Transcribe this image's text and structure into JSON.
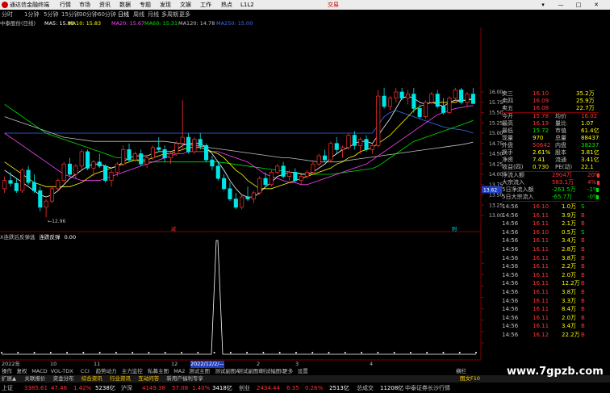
{
  "menu": {
    "app_title": "通达信金融终端",
    "items": [
      "行情",
      "市场",
      "资讯",
      "数据",
      "专题",
      "发现",
      "文娱",
      "工作",
      "热点",
      "L1L2"
    ],
    "trade": "交易",
    "window_controls": [
      "▾",
      "—",
      "□",
      "✕"
    ]
  },
  "period_bar": {
    "items": [
      "分时",
      "1分钟",
      "5分钟",
      "15分钟",
      "30分钟",
      "60分钟",
      "日线",
      "周线",
      "月线",
      "多周期",
      "更多"
    ],
    "active_index": 6
  },
  "ma_line": {
    "stock": "中泰股份(日线)",
    "items": [
      {
        "label": "MA5: 15.81",
        "color": "#ffffff"
      },
      {
        "label": "MA10: 15.83",
        "color": "#ffff00"
      },
      {
        "label": "MA20: 15.67",
        "color": "#ff44ff"
      },
      {
        "label": "MA60: 15.31",
        "color": "#00e600"
      },
      {
        "label": "MA120: 14.78",
        "color": "#c0c0c0"
      },
      {
        "label": "MA250: 15.00",
        "color": "#3c6cff"
      }
    ]
  },
  "chart_data": {
    "type": "candlestick",
    "y_ticks": [
      "16.00",
      "15.75",
      "15.50",
      "15.25",
      "15.00",
      "14.75",
      "14.50",
      "14.25",
      "14.00",
      "13.75",
      "13.50",
      "13.25",
      "13.00"
    ],
    "low_label": "←12.96",
    "price_tag": "13.62",
    "candles": [
      [
        13.65,
        13.95,
        13.55,
        13.85
      ],
      [
        13.85,
        14.05,
        13.7,
        13.78
      ],
      [
        13.78,
        13.9,
        13.55,
        13.6
      ],
      [
        13.6,
        14.15,
        13.55,
        14.1
      ],
      [
        14.1,
        14.2,
        13.75,
        13.8
      ],
      [
        13.8,
        14.0,
        13.55,
        13.6
      ],
      [
        13.6,
        13.7,
        13.1,
        13.2
      ],
      [
        13.2,
        13.4,
        12.96,
        13.35
      ],
      [
        13.35,
        13.7,
        13.3,
        13.65
      ],
      [
        13.65,
        13.9,
        13.6,
        13.85
      ],
      [
        13.85,
        14.3,
        13.8,
        14.25
      ],
      [
        14.25,
        14.4,
        13.95,
        14.0
      ],
      [
        14.0,
        14.25,
        13.9,
        14.2
      ],
      [
        14.2,
        14.6,
        14.1,
        14.55
      ],
      [
        14.55,
        14.6,
        14.1,
        14.15
      ],
      [
        14.15,
        14.35,
        13.95,
        14.3
      ],
      [
        14.3,
        14.5,
        14.15,
        14.2
      ],
      [
        14.2,
        14.25,
        13.8,
        13.85
      ],
      [
        13.85,
        14.1,
        13.7,
        14.05
      ],
      [
        14.05,
        14.3,
        13.95,
        14.25
      ],
      [
        14.25,
        14.7,
        14.2,
        14.6
      ],
      [
        14.6,
        14.75,
        14.3,
        14.35
      ],
      [
        14.35,
        14.55,
        14.3,
        14.5
      ],
      [
        14.5,
        14.6,
        14.2,
        14.25
      ],
      [
        14.25,
        14.45,
        14.15,
        14.4
      ],
      [
        14.4,
        14.7,
        14.35,
        14.65
      ],
      [
        14.65,
        14.9,
        14.55,
        14.6
      ],
      [
        14.6,
        14.7,
        14.3,
        14.4
      ],
      [
        14.4,
        14.55,
        14.25,
        14.5
      ],
      [
        14.5,
        14.8,
        14.45,
        14.75
      ],
      [
        14.75,
        15.8,
        14.6,
        14.9
      ],
      [
        14.9,
        15.0,
        14.5,
        14.55
      ],
      [
        14.55,
        14.9,
        14.5,
        14.85
      ],
      [
        14.85,
        15.0,
        14.6,
        14.7
      ],
      [
        14.7,
        14.75,
        14.3,
        14.35
      ],
      [
        14.35,
        14.45,
        14.1,
        14.2
      ],
      [
        14.2,
        14.3,
        13.85,
        13.9
      ],
      [
        13.9,
        14.0,
        13.6,
        13.65
      ],
      [
        13.65,
        13.8,
        13.35,
        13.4
      ],
      [
        13.4,
        13.55,
        13.15,
        13.2
      ],
      [
        13.2,
        13.5,
        13.15,
        13.45
      ],
      [
        13.45,
        13.7,
        13.35,
        13.4
      ],
      [
        13.4,
        13.6,
        13.3,
        13.55
      ],
      [
        13.55,
        13.95,
        13.5,
        13.9
      ],
      [
        13.9,
        14.05,
        13.7,
        13.75
      ],
      [
        13.75,
        14.1,
        13.7,
        14.05
      ],
      [
        14.05,
        14.25,
        14.0,
        14.2
      ],
      [
        14.2,
        14.3,
        13.9,
        13.95
      ],
      [
        13.95,
        14.1,
        13.85,
        14.05
      ],
      [
        14.05,
        14.15,
        13.8,
        13.85
      ],
      [
        13.85,
        14.0,
        13.75,
        13.95
      ],
      [
        13.95,
        14.1,
        13.9,
        14.05
      ],
      [
        14.05,
        14.3,
        14.0,
        14.25
      ],
      [
        14.25,
        14.5,
        14.2,
        14.45
      ],
      [
        14.45,
        14.6,
        14.3,
        14.35
      ],
      [
        14.35,
        14.8,
        14.3,
        14.75
      ],
      [
        14.75,
        14.9,
        14.5,
        14.6
      ],
      [
        14.6,
        14.7,
        14.4,
        14.65
      ],
      [
        14.65,
        15.0,
        14.6,
        14.95
      ],
      [
        14.95,
        15.05,
        14.6,
        14.7
      ],
      [
        14.7,
        14.9,
        14.5,
        14.85
      ],
      [
        14.85,
        14.95,
        14.55,
        14.6
      ],
      [
        14.6,
        14.75,
        14.5,
        14.7
      ],
      [
        14.7,
        16.05,
        14.65,
        15.9
      ],
      [
        15.9,
        16.1,
        15.6,
        15.65
      ],
      [
        15.65,
        15.9,
        15.55,
        15.85
      ],
      [
        15.85,
        16.1,
        15.75,
        16.0
      ],
      [
        16.0,
        16.1,
        15.8,
        15.85
      ],
      [
        15.85,
        16.05,
        15.7,
        15.95
      ],
      [
        15.95,
        16.1,
        15.5,
        15.6
      ],
      [
        15.6,
        15.7,
        15.35,
        15.4
      ],
      [
        15.4,
        15.8,
        15.35,
        15.75
      ],
      [
        15.75,
        16.0,
        15.7,
        15.95
      ],
      [
        15.95,
        16.05,
        15.6,
        15.65
      ],
      [
        15.65,
        15.85,
        15.45,
        15.5
      ],
      [
        15.5,
        15.9,
        15.45,
        15.85
      ],
      [
        15.85,
        16.1,
        15.8,
        16.05
      ],
      [
        16.05,
        16.1,
        15.7,
        15.75
      ],
      [
        15.75,
        16.0,
        15.65,
        15.95
      ],
      [
        15.95,
        16.1,
        15.7,
        15.72
      ]
    ],
    "ma5": [
      14.1,
      14.0,
      13.9,
      13.8,
      13.7,
      13.6,
      13.5,
      13.45,
      13.5,
      13.6,
      13.75,
      13.9,
      14.0,
      14.1,
      14.2,
      14.25,
      14.25,
      14.2,
      14.15,
      14.2,
      14.3,
      14.4,
      14.45,
      14.45,
      14.45,
      14.5,
      14.55,
      14.55,
      14.55,
      14.6,
      14.7,
      14.75,
      14.75,
      14.75,
      14.65,
      14.5,
      14.3,
      14.1,
      13.85,
      13.65,
      13.5,
      13.45,
      13.45,
      13.55,
      13.7,
      13.8,
      13.95,
      14.0,
      14.05,
      14.05,
      14.0,
      14.0,
      14.05,
      14.15,
      14.25,
      14.4,
      14.5,
      14.6,
      14.65,
      14.75,
      14.8,
      14.8,
      14.75,
      14.95,
      15.15,
      15.35,
      15.6,
      15.85,
      15.9,
      15.85,
      15.75,
      15.7,
      15.75,
      15.7,
      15.65,
      15.75,
      15.8,
      15.8,
      15.8,
      15.85
    ],
    "ma10": [
      14.3,
      14.2,
      14.1,
      14.0,
      13.9,
      13.8,
      13.75,
      13.7,
      13.7,
      13.7,
      13.7,
      13.7,
      13.75,
      13.8,
      13.9,
      14.0,
      14.05,
      14.1,
      14.15,
      14.2,
      14.25,
      14.3,
      14.35,
      14.35,
      14.35,
      14.4,
      14.45,
      14.5,
      14.5,
      14.55,
      14.6,
      14.65,
      14.65,
      14.65,
      14.6,
      14.55,
      14.5,
      14.4,
      14.25,
      14.1,
      14.0,
      13.85,
      13.75,
      13.65,
      13.65,
      13.65,
      13.7,
      13.75,
      13.8,
      13.85,
      13.9,
      13.95,
      14.0,
      14.05,
      14.1,
      14.15,
      14.25,
      14.3,
      14.4,
      14.45,
      14.55,
      14.6,
      14.65,
      14.75,
      14.85,
      14.95,
      15.1,
      15.25,
      15.4,
      15.55,
      15.65,
      15.7,
      15.75,
      15.75,
      15.75,
      15.75,
      15.75,
      15.8,
      15.8,
      15.83
    ],
    "ma20": [
      15.0,
      14.9,
      14.8,
      14.7,
      14.6,
      14.5,
      14.4,
      14.3,
      14.2,
      14.1,
      14.0,
      13.95,
      13.9,
      13.85,
      13.85,
      13.85,
      13.85,
      13.9,
      13.95,
      14.0,
      14.05,
      14.1,
      14.15,
      14.2,
      14.25,
      14.3,
      14.35,
      14.4,
      14.45,
      14.5,
      14.5,
      14.55,
      14.55,
      14.55,
      14.55,
      14.55,
      14.55,
      14.5,
      14.45,
      14.4,
      14.35,
      14.3,
      14.2,
      14.1,
      14.0,
      13.95,
      13.9,
      13.85,
      13.8,
      13.8,
      13.75,
      13.75,
      13.8,
      13.85,
      13.9,
      13.95,
      14.0,
      14.05,
      14.1,
      14.15,
      14.2,
      14.25,
      14.35,
      14.45,
      14.55,
      14.65,
      14.75,
      14.85,
      14.95,
      15.05,
      15.15,
      15.25,
      15.35,
      15.45,
      15.5,
      15.55,
      15.6,
      15.62,
      15.65,
      15.67
    ],
    "ma60": [
      15.7,
      15.6,
      15.5,
      15.4,
      15.3,
      15.2,
      15.1,
      15.0,
      14.95,
      14.9,
      14.85,
      14.8,
      14.75,
      14.7,
      14.65,
      14.6,
      14.55,
      14.5,
      14.45,
      14.4,
      14.4,
      14.35,
      14.35,
      14.3,
      14.3,
      14.3,
      14.3,
      14.3,
      14.3,
      14.3,
      14.3,
      14.3,
      14.3,
      14.3,
      14.3,
      14.3,
      14.3,
      14.28,
      14.26,
      14.24,
      14.22,
      14.2,
      14.18,
      14.16,
      14.14,
      14.12,
      14.1,
      14.08,
      14.06,
      14.04,
      14.02,
      14.0,
      14.0,
      14.0,
      14.0,
      14.0,
      14.02,
      14.04,
      14.06,
      14.08,
      14.1,
      14.12,
      14.14,
      14.2,
      14.3,
      14.4,
      14.5,
      14.6,
      14.7,
      14.8,
      14.85,
      14.9,
      14.95,
      15.0,
      15.05,
      15.1,
      15.15,
      15.2,
      15.25,
      15.31
    ],
    "ma120": [
      15.4,
      15.35,
      15.3,
      15.25,
      15.2,
      15.15,
      15.1,
      15.05,
      15.0,
      14.95,
      14.9,
      14.88,
      14.86,
      14.84,
      14.82,
      14.8,
      14.8,
      14.8,
      14.8,
      14.8,
      14.8,
      14.8,
      14.8,
      14.8,
      14.8,
      14.8,
      14.8,
      14.8,
      14.78,
      14.76,
      14.74,
      14.72,
      14.7,
      14.68,
      14.66,
      14.64,
      14.62,
      14.6,
      14.58,
      14.56,
      14.54,
      14.52,
      14.5,
      14.48,
      14.46,
      14.44,
      14.42,
      14.4,
      14.4,
      14.38,
      14.36,
      14.34,
      14.32,
      14.3,
      14.3,
      14.3,
      14.3,
      14.32,
      14.34,
      14.36,
      14.38,
      14.4,
      14.42,
      14.44,
      14.46,
      14.48,
      14.5,
      14.52,
      14.54,
      14.56,
      14.58,
      14.6,
      14.62,
      14.64,
      14.66,
      14.68,
      14.7,
      14.72,
      14.75,
      14.78
    ],
    "ma250": [
      15.0,
      15.0,
      15.0,
      15.0,
      15.0,
      15.0,
      15.0,
      15.0,
      15.0,
      15.0,
      15.0,
      15.0,
      15.0,
      15.0,
      15.0,
      15.0,
      15.0,
      15.0,
      15.0,
      15.0,
      15.0,
      15.0,
      15.0,
      15.0,
      15.0,
      15.0,
      15.0,
      15.0,
      15.0,
      15.0,
      15.0,
      15.0,
      15.0,
      15.0,
      15.0,
      15.0,
      15.0,
      15.0,
      15.0,
      15.0,
      15.0,
      15.0,
      15.0,
      15.0,
      15.0,
      15.0,
      15.0,
      15.0,
      15.0,
      15.0,
      15.0,
      15.0,
      15.0,
      15.0,
      15.0,
      15.0,
      15.0,
      15.0,
      15.0,
      15.0,
      15.0,
      15.0,
      15.0,
      15.2,
      15.4,
      15.5,
      15.55,
      15.5,
      15.45,
      15.4,
      15.35,
      15.3,
      15.25,
      15.2,
      15.15,
      15.12,
      15.1,
      15.08,
      15.05,
      15.0
    ],
    "markers": [
      "减",
      "则"
    ],
    "indicator": {
      "title": "X连跌后反弹选",
      "name": "连跌反弹",
      "value": "0.00",
      "spike_positions": [
        22,
        80
      ]
    },
    "x_labels": [
      "2022年",
      "10",
      "11",
      "12",
      "2022/12/2/—",
      "2",
      "3",
      "4"
    ]
  },
  "right_panel": {
    "sell_rows": [
      {
        "label": "卖三",
        "price": "16.10",
        "vol": "35.2万"
      },
      {
        "label": "卖四",
        "price": "16.09",
        "vol": "25.9万"
      },
      {
        "label": "卖五",
        "price": "16.08",
        "vol": "22.7万"
      }
    ],
    "stats": [
      {
        "a": "今开",
        "b": "15.78",
        "c": "均价",
        "d": "16.02"
      },
      {
        "a": "最高",
        "b": "16.19",
        "c": "量比",
        "d": "1.07"
      },
      {
        "a": "最低",
        "b": "15.72",
        "c": "市值",
        "d": "61.4亿"
      },
      {
        "a": "现量",
        "b": "970",
        "c": "总量",
        "d": "88437"
      },
      {
        "a": "外盘",
        "b": "50642",
        "c": "内盘",
        "d": "38237"
      },
      {
        "a": "换手",
        "b": "2.61%",
        "c": "股本",
        "d": "3.81亿"
      },
      {
        "a": "净资",
        "b": "7.41",
        "c": "流通",
        "d": "3.41亿"
      },
      {
        "a": "收益(四)",
        "b": "0.730",
        "c": "PE(动)",
        "d": "22.1"
      }
    ],
    "flow": [
      {
        "label": "净流入额",
        "val": "2904万",
        "pct": "20%"
      },
      {
        "label": "大宗流入",
        "val": "583.1万",
        "pct": "4%"
      },
      {
        "label": "5日净流入额",
        "val": "-263.5万",
        "pct": "-1%"
      },
      {
        "label": "5日大宗流入",
        "val": "-65.7万",
        "pct": "-0%"
      }
    ],
    "ticks": [
      {
        "t": "14:56",
        "p": "16.10",
        "v": "1.0万",
        "d": "S",
        "dc": "green"
      },
      {
        "t": "14:56",
        "p": "16.11",
        "v": "3.9万",
        "d": "B",
        "dc": "red"
      },
      {
        "t": "14:56",
        "p": "16.11",
        "v": "2.1万",
        "d": "B",
        "dc": "red"
      },
      {
        "t": "14:56",
        "p": "16.10",
        "v": "0.5万",
        "d": "S",
        "dc": "green"
      },
      {
        "t": "14:56",
        "p": "16.11",
        "v": "3.4万",
        "d": "B",
        "dc": "red"
      },
      {
        "t": "14:56",
        "p": "16.11",
        "v": "2.8万",
        "d": "B",
        "dc": "red"
      },
      {
        "t": "14:56",
        "p": "16.11",
        "v": "3.8万",
        "d": "B",
        "dc": "red"
      },
      {
        "t": "14:56",
        "p": "16.11",
        "v": "2.2万",
        "d": "B",
        "dc": "red"
      },
      {
        "t": "14:56",
        "p": "16.11",
        "v": "2.0万",
        "d": "B",
        "dc": "red"
      },
      {
        "t": "14:56",
        "p": "16.11",
        "v": "12.2万",
        "d": "B",
        "dc": "red"
      },
      {
        "t": "14:56",
        "p": "16.11",
        "v": "3.8万",
        "d": "B",
        "dc": "red"
      },
      {
        "t": "14:56",
        "p": "16.11",
        "v": "3.3万",
        "d": "B",
        "dc": "red"
      },
      {
        "t": "14:56",
        "p": "16.11",
        "v": "8.4万",
        "d": "B",
        "dc": "red"
      },
      {
        "t": "14:56",
        "p": "16.11",
        "v": "2.0万",
        "d": "B",
        "dc": "red"
      },
      {
        "t": "14:56",
        "p": "16.11",
        "v": "3.4万",
        "d": "B",
        "dc": "red"
      },
      {
        "t": "14:56",
        "p": "16.12",
        "v": "22.2万",
        "d": "B",
        "dc": "red"
      }
    ]
  },
  "tabs1": [
    "操作",
    "复权",
    "MACD",
    "VOL-TDX",
    "CCI",
    "趋势动力",
    "主力监控",
    "私募主图",
    "MA2",
    "测试主图",
    "测试副图A",
    "测试副图B",
    "测试幅图C",
    "更多",
    "设置"
  ],
  "tabs1_right": "横栏",
  "tabs2": [
    "扩展▲",
    "关联报价",
    "资金分布",
    "综合资讯",
    "行业资讯",
    "互动问答",
    "新用户福利专享"
  ],
  "tabs2_right": "图文F10",
  "status": [
    {
      "text": "上证",
      "c": "#c0c0c0"
    },
    {
      "text": "3385.61",
      "c": "#ff3232"
    },
    {
      "text": "47.46",
      "c": "#ff3232"
    },
    {
      "text": "1.42%",
      "c": "#ff3232"
    },
    {
      "text": "5238亿",
      "c": "#ffffff"
    },
    {
      "text": "沪深",
      "c": "#c0c0c0"
    },
    {
      "text": "4149.38",
      "c": "#ff3232"
    },
    {
      "text": "57.08",
      "c": "#ff3232"
    },
    {
      "text": "1.40%",
      "c": "#ff3232"
    },
    {
      "text": "3418亿",
      "c": "#ffffff"
    },
    {
      "text": "创业",
      "c": "#c0c0c0"
    },
    {
      "text": "2434.44",
      "c": "#ff3232"
    },
    {
      "text": "6.35",
      "c": "#ff3232"
    },
    {
      "text": "0.26%",
      "c": "#ff3232"
    },
    {
      "text": "2513亿",
      "c": "#ffffff"
    },
    {
      "text": "总成交",
      "c": "#c0c0c0"
    },
    {
      "text": "11208亿",
      "c": "#ffffff"
    },
    {
      "text": "中泰证券长沙行情",
      "c": "#c0c0c0"
    }
  ],
  "watermark": "www.7gpzb.com"
}
